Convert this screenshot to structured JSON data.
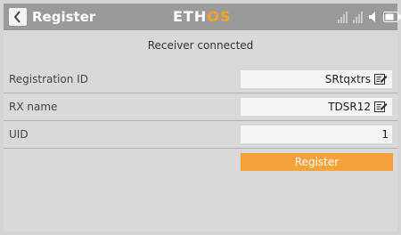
{
  "header": {
    "title": "Register",
    "logo_main": "ETH",
    "logo_accent": "OS",
    "back_icon": "chevron-left-icon",
    "status_icons": [
      "signal-bars-icon",
      "signal-bars-icon",
      "speaker-icon",
      "battery-icon"
    ]
  },
  "status": {
    "message": "Receiver connected"
  },
  "fields": [
    {
      "label": "Registration ID",
      "value": "SRtqxtrs",
      "editable": true
    },
    {
      "label": "RX name",
      "value": "TDSR12",
      "editable": true
    },
    {
      "label": "UID",
      "value": "1",
      "editable": false
    }
  ],
  "actions": {
    "register_label": "Register"
  },
  "colors": {
    "header_bg": "#9a9a9a",
    "accent": "#ffa21e",
    "button": "#f4a23a"
  }
}
